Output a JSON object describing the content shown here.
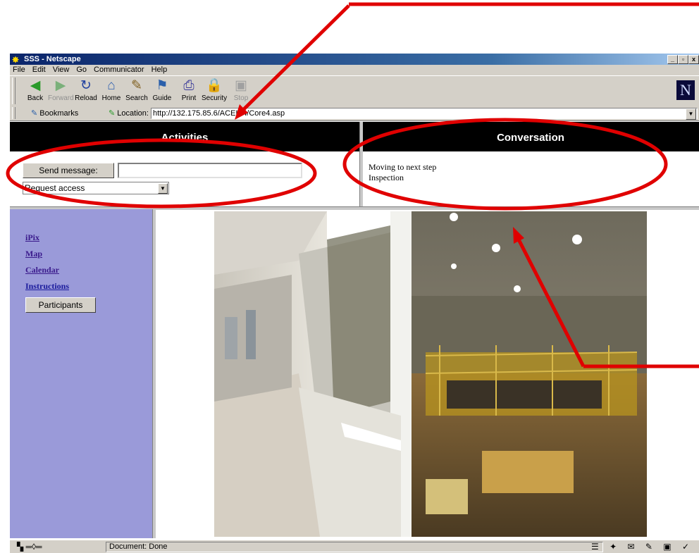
{
  "window": {
    "title": "SSS - Netscape",
    "controls": [
      "_",
      "▫",
      "x"
    ]
  },
  "menu": [
    "File",
    "Edit",
    "View",
    "Go",
    "Communicator",
    "Help"
  ],
  "toolbar": {
    "buttons": [
      {
        "label": "Back",
        "icon": "back-arrow-icon",
        "glyph": "◀",
        "color": "#2a9a2a"
      },
      {
        "label": "Forward",
        "icon": "forward-arrow-icon",
        "glyph": "▶",
        "color": "#7ab07a"
      },
      {
        "label": "Reload",
        "icon": "reload-icon",
        "glyph": "↻",
        "color": "#1f3f9f"
      },
      {
        "label": "Home",
        "icon": "home-icon",
        "glyph": "⌂",
        "color": "#3060b0"
      },
      {
        "label": "Search",
        "icon": "search-icon",
        "glyph": "✎",
        "color": "#806020"
      },
      {
        "label": "Guide",
        "icon": "guide-icon",
        "glyph": "⚑",
        "color": "#2a5faa"
      },
      {
        "label": "Print",
        "icon": "print-icon",
        "glyph": "⎙",
        "color": "#3a3a9a"
      },
      {
        "label": "Security",
        "icon": "security-lock-icon",
        "glyph": "🔒",
        "color": "#b08000"
      },
      {
        "label": "Stop",
        "icon": "stop-icon",
        "glyph": "▣",
        "color": "#a0a0a0"
      }
    ],
    "brand_glyph": "N"
  },
  "location": {
    "bookmarks_label": "Bookmarks",
    "location_label": "Location:",
    "url": "http://132.175.85.6/ACEIT4/Core4.asp"
  },
  "page": {
    "activities_header": "Activities",
    "conversation_header": "Conversation",
    "send_button": "Send message:",
    "message_value": "",
    "request_select": "Request access",
    "conversation_lines": [
      "Moving to next step",
      "Inspection"
    ],
    "nav_links": [
      "iPix",
      "Map",
      "Calendar",
      "Instructions"
    ],
    "participants_button": "Participants"
  },
  "status": {
    "text": "Document: Done"
  },
  "colors": {
    "sidebar": "#9a9ad9",
    "annotation_red": "#e00000",
    "header_bg": "#000000"
  }
}
